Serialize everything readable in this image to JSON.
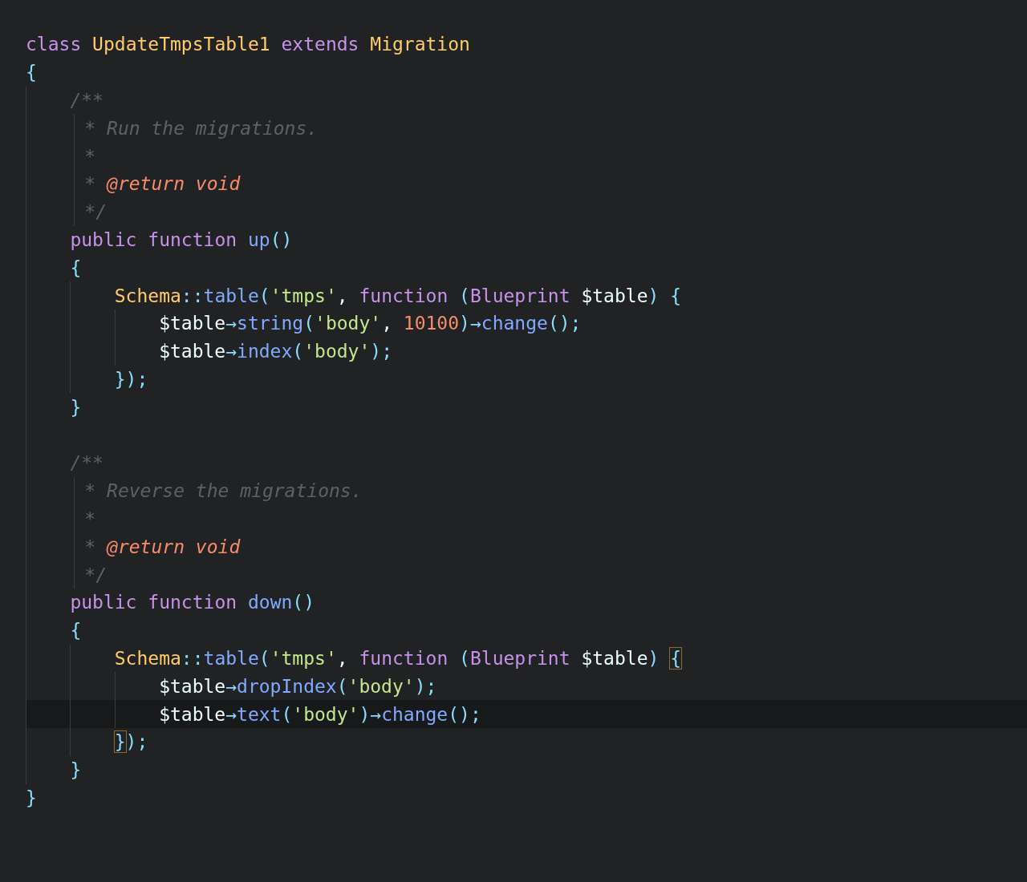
{
  "editor": {
    "lines": [
      {
        "kind": "code",
        "tokens": [
          {
            "text": "class ",
            "kind": "keyword"
          },
          {
            "text": "UpdateTmpsTable1",
            "kind": "class"
          },
          {
            "text": " extends ",
            "kind": "keyword"
          },
          {
            "text": "Migration",
            "kind": "class"
          }
        ]
      },
      {
        "kind": "code",
        "tokens": [
          {
            "text": "{",
            "kind": "punct"
          }
        ],
        "children": [
          {
            "kind": "comment",
            "tokens": [
              {
                "text": "/**",
                "kind": "comment"
              }
            ],
            "children": [
              {
                "kind": "comment",
                "tokens": [
                  {
                    "text": "* Run the migrations.",
                    "kind": "comment"
                  }
                ]
              },
              {
                "kind": "comment",
                "tokens": [
                  {
                    "text": "*",
                    "kind": "comment"
                  }
                ]
              },
              {
                "kind": "comment",
                "tokens": [
                  {
                    "text": "* ",
                    "kind": "comment"
                  },
                  {
                    "text": "@return void",
                    "kind": "doctag"
                  }
                ]
              },
              {
                "kind": "comment",
                "tokens": [
                  {
                    "text": "*/",
                    "kind": "comment"
                  }
                ]
              }
            ]
          },
          {
            "kind": "code",
            "tokens": [
              {
                "text": "public function ",
                "kind": "keyword"
              },
              {
                "text": "up",
                "kind": "function"
              },
              {
                "text": "()",
                "kind": "punct"
              }
            ]
          },
          {
            "kind": "code",
            "tokens": [
              {
                "text": "{",
                "kind": "punct"
              }
            ],
            "children": [
              {
                "kind": "code",
                "tokens": [
                  {
                    "text": "Schema",
                    "kind": "class"
                  },
                  {
                    "text": "::",
                    "kind": "punct"
                  },
                  {
                    "text": "table",
                    "kind": "function"
                  },
                  {
                    "text": "(",
                    "kind": "punct"
                  },
                  {
                    "text": "'tmps'",
                    "kind": "string"
                  },
                  {
                    "text": ", ",
                    "kind": "plain"
                  },
                  {
                    "text": "function ",
                    "kind": "keyword"
                  },
                  {
                    "text": "(",
                    "kind": "punct"
                  },
                  {
                    "text": "Blueprint ",
                    "kind": "type"
                  },
                  {
                    "text": "$table",
                    "kind": "variable"
                  },
                  {
                    "text": ") ",
                    "kind": "punct"
                  },
                  {
                    "text": "{",
                    "kind": "punct",
                    "matched": false
                  }
                ],
                "children": [
                  {
                    "kind": "code",
                    "tokens": [
                      {
                        "text": "$table",
                        "kind": "variable"
                      },
                      {
                        "text": "→",
                        "kind": "punct"
                      },
                      {
                        "text": "string",
                        "kind": "function"
                      },
                      {
                        "text": "(",
                        "kind": "punct"
                      },
                      {
                        "text": "'body'",
                        "kind": "string"
                      },
                      {
                        "text": ", ",
                        "kind": "plain"
                      },
                      {
                        "text": "10100",
                        "kind": "number"
                      },
                      {
                        "text": ")→",
                        "kind": "punct"
                      },
                      {
                        "text": "change",
                        "kind": "function"
                      },
                      {
                        "text": "();",
                        "kind": "punct"
                      }
                    ]
                  },
                  {
                    "kind": "code",
                    "tokens": [
                      {
                        "text": "$table",
                        "kind": "variable"
                      },
                      {
                        "text": "→",
                        "kind": "punct"
                      },
                      {
                        "text": "index",
                        "kind": "function"
                      },
                      {
                        "text": "(",
                        "kind": "punct"
                      },
                      {
                        "text": "'body'",
                        "kind": "string"
                      },
                      {
                        "text": ");",
                        "kind": "punct"
                      }
                    ]
                  }
                ]
              },
              {
                "kind": "code",
                "tokens": [
                  {
                    "text": "}",
                    "kind": "punct",
                    "matched": false
                  },
                  {
                    "text": ");",
                    "kind": "punct"
                  }
                ]
              }
            ]
          },
          {
            "kind": "code",
            "tokens": [
              {
                "text": "}",
                "kind": "punct"
              }
            ]
          },
          {
            "kind": "blank"
          },
          {
            "kind": "comment",
            "tokens": [
              {
                "text": "/**",
                "kind": "comment"
              }
            ],
            "children": [
              {
                "kind": "comment",
                "tokens": [
                  {
                    "text": "* Reverse the migrations.",
                    "kind": "comment"
                  }
                ]
              },
              {
                "kind": "comment",
                "tokens": [
                  {
                    "text": "*",
                    "kind": "comment"
                  }
                ]
              },
              {
                "kind": "comment",
                "tokens": [
                  {
                    "text": "* ",
                    "kind": "comment"
                  },
                  {
                    "text": "@return void",
                    "kind": "doctag"
                  }
                ]
              },
              {
                "kind": "comment",
                "tokens": [
                  {
                    "text": "*/",
                    "kind": "comment"
                  }
                ]
              }
            ]
          },
          {
            "kind": "code",
            "tokens": [
              {
                "text": "public function ",
                "kind": "keyword"
              },
              {
                "text": "down",
                "kind": "function"
              },
              {
                "text": "()",
                "kind": "punct"
              }
            ]
          },
          {
            "kind": "code",
            "tokens": [
              {
                "text": "{",
                "kind": "punct"
              }
            ],
            "children": [
              {
                "kind": "code",
                "tokens": [
                  {
                    "text": "Schema",
                    "kind": "class"
                  },
                  {
                    "text": "::",
                    "kind": "punct"
                  },
                  {
                    "text": "table",
                    "kind": "function"
                  },
                  {
                    "text": "(",
                    "kind": "punct"
                  },
                  {
                    "text": "'tmps'",
                    "kind": "string"
                  },
                  {
                    "text": ", ",
                    "kind": "plain"
                  },
                  {
                    "text": "function ",
                    "kind": "keyword"
                  },
                  {
                    "text": "(",
                    "kind": "punct"
                  },
                  {
                    "text": "Blueprint ",
                    "kind": "type"
                  },
                  {
                    "text": "$table",
                    "kind": "variable"
                  },
                  {
                    "text": ") ",
                    "kind": "punct"
                  },
                  {
                    "text": "{",
                    "kind": "punct",
                    "matched": true
                  }
                ],
                "children": [
                  {
                    "kind": "code",
                    "tokens": [
                      {
                        "text": "$table",
                        "kind": "variable"
                      },
                      {
                        "text": "→",
                        "kind": "punct"
                      },
                      {
                        "text": "dropIndex",
                        "kind": "function"
                      },
                      {
                        "text": "(",
                        "kind": "punct"
                      },
                      {
                        "text": "'body'",
                        "kind": "string"
                      },
                      {
                        "text": ");",
                        "kind": "punct"
                      }
                    ]
                  },
                  {
                    "kind": "code",
                    "current": true,
                    "tokens": [
                      {
                        "text": "$table",
                        "kind": "variable"
                      },
                      {
                        "text": "→",
                        "kind": "punct"
                      },
                      {
                        "text": "text",
                        "kind": "function"
                      },
                      {
                        "text": "(",
                        "kind": "punct"
                      },
                      {
                        "text": "'body'",
                        "kind": "string"
                      },
                      {
                        "text": ")→",
                        "kind": "punct"
                      },
                      {
                        "text": "change",
                        "kind": "function"
                      },
                      {
                        "text": "();",
                        "kind": "punct"
                      }
                    ]
                  }
                ]
              },
              {
                "kind": "code",
                "tokens": [
                  {
                    "text": "}",
                    "kind": "punct",
                    "matched": true
                  },
                  {
                    "text": ");",
                    "kind": "punct"
                  }
                ]
              }
            ]
          },
          {
            "kind": "code",
            "tokens": [
              {
                "text": "}",
                "kind": "punct"
              }
            ]
          }
        ]
      },
      {
        "kind": "code",
        "tokens": [
          {
            "text": "}",
            "kind": "punct"
          }
        ]
      }
    ]
  }
}
